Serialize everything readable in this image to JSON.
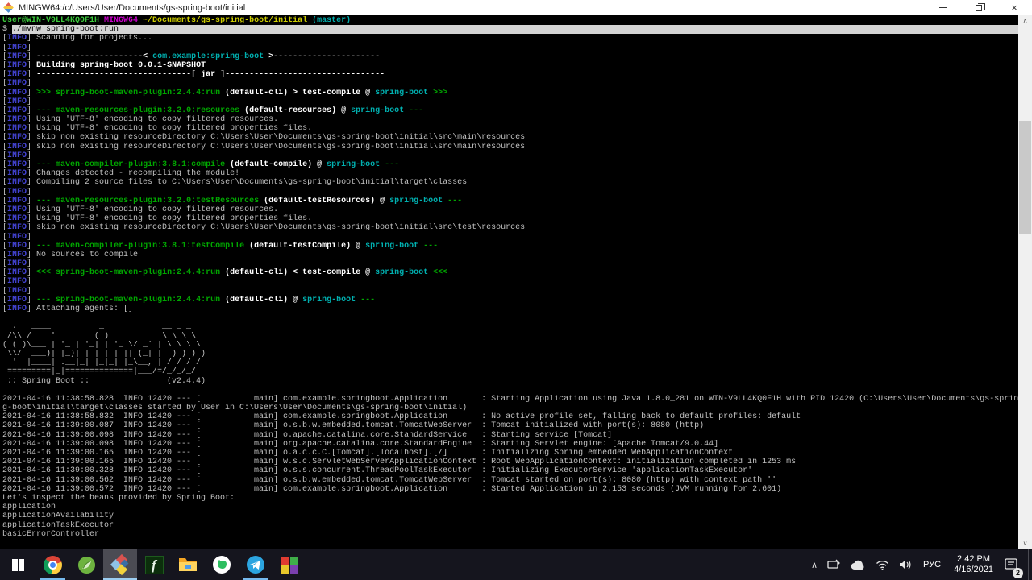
{
  "window": {
    "title": "MINGW64:/c/Users/User/Documents/gs-spring-boot/initial",
    "controls": {
      "minimize": "minimize",
      "restore": "restore",
      "close": "close"
    }
  },
  "colors": {
    "terminal_bg": "#000000",
    "default_text": "#c0c0c0",
    "info_blue": "#4444d6",
    "maven_green": "#00a600",
    "project_cyan": "#00b0b0",
    "prompt_green": "#3ccc3c",
    "path_yellow": "#cdcd00",
    "mingw_magenta": "#cd00cd",
    "selection_bg": "#d4d4d4",
    "taskbar_bg": "#15151e",
    "running_underline": "#76b9ed"
  },
  "terminal": {
    "lines": [
      {
        "s": [
          [
            "pg",
            "User@WIN-V9LL4KQ0F1H "
          ],
          [
            "m",
            "MINGW64 "
          ],
          [
            "y",
            "~/Documents/gs-spring-boot/initial "
          ],
          [
            "c",
            "(master)"
          ]
        ]
      },
      {
        "s": [
          [
            "d",
            "$ "
          ],
          [
            "sel",
            "./mvnw spring-boot:run"
          ]
        ]
      },
      {
        "s": [
          [
            "d",
            "["
          ],
          [
            "b",
            "INFO"
          ],
          [
            "d",
            "] Scanning for projects..."
          ]
        ]
      },
      {
        "s": [
          [
            "d",
            "["
          ],
          [
            "b",
            "INFO"
          ],
          [
            "d",
            "]"
          ]
        ]
      },
      {
        "s": [
          [
            "d",
            "["
          ],
          [
            "b",
            "INFO"
          ],
          [
            "d",
            "] "
          ],
          [
            "w",
            "----------------------< "
          ],
          [
            "c",
            "com.example:spring-boot"
          ],
          [
            "w",
            " >----------------------"
          ]
        ]
      },
      {
        "s": [
          [
            "d",
            "["
          ],
          [
            "b",
            "INFO"
          ],
          [
            "d",
            "] "
          ],
          [
            "w",
            "Building spring-boot 0.0.1-SNAPSHOT"
          ]
        ]
      },
      {
        "s": [
          [
            "d",
            "["
          ],
          [
            "b",
            "INFO"
          ],
          [
            "d",
            "] "
          ],
          [
            "w",
            "--------------------------------[ jar ]---------------------------------"
          ]
        ]
      },
      {
        "s": [
          [
            "d",
            "["
          ],
          [
            "b",
            "INFO"
          ],
          [
            "d",
            "]"
          ]
        ]
      },
      {
        "s": [
          [
            "d",
            "["
          ],
          [
            "b",
            "INFO"
          ],
          [
            "d",
            "] "
          ],
          [
            "g",
            ">>> spring-boot-maven-plugin:2.4.4:run "
          ],
          [
            "w",
            "(default-cli) > test-compile @ "
          ],
          [
            "c",
            "spring-boot"
          ],
          [
            "g",
            " >>>"
          ]
        ]
      },
      {
        "s": [
          [
            "d",
            "["
          ],
          [
            "b",
            "INFO"
          ],
          [
            "d",
            "]"
          ]
        ]
      },
      {
        "s": [
          [
            "d",
            "["
          ],
          [
            "b",
            "INFO"
          ],
          [
            "d",
            "] "
          ],
          [
            "g",
            "--- maven-resources-plugin:3.2.0:resources "
          ],
          [
            "w",
            "(default-resources) @ "
          ],
          [
            "c",
            "spring-boot"
          ],
          [
            "g",
            " ---"
          ]
        ]
      },
      {
        "s": [
          [
            "d",
            "["
          ],
          [
            "b",
            "INFO"
          ],
          [
            "d",
            "] Using 'UTF-8' encoding to copy filtered resources."
          ]
        ]
      },
      {
        "s": [
          [
            "d",
            "["
          ],
          [
            "b",
            "INFO"
          ],
          [
            "d",
            "] Using 'UTF-8' encoding to copy filtered properties files."
          ]
        ]
      },
      {
        "s": [
          [
            "d",
            "["
          ],
          [
            "b",
            "INFO"
          ],
          [
            "d",
            "] skip non existing resourceDirectory C:\\Users\\User\\Documents\\gs-spring-boot\\initial\\src\\main\\resources"
          ]
        ]
      },
      {
        "s": [
          [
            "d",
            "["
          ],
          [
            "b",
            "INFO"
          ],
          [
            "d",
            "] skip non existing resourceDirectory C:\\Users\\User\\Documents\\gs-spring-boot\\initial\\src\\main\\resources"
          ]
        ]
      },
      {
        "s": [
          [
            "d",
            "["
          ],
          [
            "b",
            "INFO"
          ],
          [
            "d",
            "]"
          ]
        ]
      },
      {
        "s": [
          [
            "d",
            "["
          ],
          [
            "b",
            "INFO"
          ],
          [
            "d",
            "] "
          ],
          [
            "g",
            "--- maven-compiler-plugin:3.8.1:compile "
          ],
          [
            "w",
            "(default-compile) @ "
          ],
          [
            "c",
            "spring-boot"
          ],
          [
            "g",
            " ---"
          ]
        ]
      },
      {
        "s": [
          [
            "d",
            "["
          ],
          [
            "b",
            "INFO"
          ],
          [
            "d",
            "] Changes detected - recompiling the module!"
          ]
        ]
      },
      {
        "s": [
          [
            "d",
            "["
          ],
          [
            "b",
            "INFO"
          ],
          [
            "d",
            "] Compiling 2 source files to C:\\Users\\User\\Documents\\gs-spring-boot\\initial\\target\\classes"
          ]
        ]
      },
      {
        "s": [
          [
            "d",
            "["
          ],
          [
            "b",
            "INFO"
          ],
          [
            "d",
            "]"
          ]
        ]
      },
      {
        "s": [
          [
            "d",
            "["
          ],
          [
            "b",
            "INFO"
          ],
          [
            "d",
            "] "
          ],
          [
            "g",
            "--- maven-resources-plugin:3.2.0:testResources "
          ],
          [
            "w",
            "(default-testResources) @ "
          ],
          [
            "c",
            "spring-boot"
          ],
          [
            "g",
            " ---"
          ]
        ]
      },
      {
        "s": [
          [
            "d",
            "["
          ],
          [
            "b",
            "INFO"
          ],
          [
            "d",
            "] Using 'UTF-8' encoding to copy filtered resources."
          ]
        ]
      },
      {
        "s": [
          [
            "d",
            "["
          ],
          [
            "b",
            "INFO"
          ],
          [
            "d",
            "] Using 'UTF-8' encoding to copy filtered properties files."
          ]
        ]
      },
      {
        "s": [
          [
            "d",
            "["
          ],
          [
            "b",
            "INFO"
          ],
          [
            "d",
            "] skip non existing resourceDirectory C:\\Users\\User\\Documents\\gs-spring-boot\\initial\\src\\test\\resources"
          ]
        ]
      },
      {
        "s": [
          [
            "d",
            "["
          ],
          [
            "b",
            "INFO"
          ],
          [
            "d",
            "]"
          ]
        ]
      },
      {
        "s": [
          [
            "d",
            "["
          ],
          [
            "b",
            "INFO"
          ],
          [
            "d",
            "] "
          ],
          [
            "g",
            "--- maven-compiler-plugin:3.8.1:testCompile "
          ],
          [
            "w",
            "(default-testCompile) @ "
          ],
          [
            "c",
            "spring-boot"
          ],
          [
            "g",
            " ---"
          ]
        ]
      },
      {
        "s": [
          [
            "d",
            "["
          ],
          [
            "b",
            "INFO"
          ],
          [
            "d",
            "] No sources to compile"
          ]
        ]
      },
      {
        "s": [
          [
            "d",
            "["
          ],
          [
            "b",
            "INFO"
          ],
          [
            "d",
            "]"
          ]
        ]
      },
      {
        "s": [
          [
            "d",
            "["
          ],
          [
            "b",
            "INFO"
          ],
          [
            "d",
            "] "
          ],
          [
            "g",
            "<<< spring-boot-maven-plugin:2.4.4:run "
          ],
          [
            "w",
            "(default-cli) < test-compile @ "
          ],
          [
            "c",
            "spring-boot"
          ],
          [
            "g",
            " <<<"
          ]
        ]
      },
      {
        "s": [
          [
            "d",
            "["
          ],
          [
            "b",
            "INFO"
          ],
          [
            "d",
            "]"
          ]
        ]
      },
      {
        "s": [
          [
            "d",
            "["
          ],
          [
            "b",
            "INFO"
          ],
          [
            "d",
            "]"
          ]
        ]
      },
      {
        "s": [
          [
            "d",
            "["
          ],
          [
            "b",
            "INFO"
          ],
          [
            "d",
            "] "
          ],
          [
            "g",
            "--- spring-boot-maven-plugin:2.4.4:run "
          ],
          [
            "w",
            "(default-cli) @ "
          ],
          [
            "c",
            "spring-boot"
          ],
          [
            "g",
            " ---"
          ]
        ]
      },
      {
        "s": [
          [
            "d",
            "["
          ],
          [
            "b",
            "INFO"
          ],
          [
            "d",
            "] Attaching agents: []"
          ]
        ]
      },
      {
        "s": []
      },
      {
        "s": [
          [
            "d",
            "  .   ____          _            __ _ _"
          ]
        ]
      },
      {
        "s": [
          [
            "d",
            " /\\\\ / ___'_ __ _ _(_)_ __  __ _ \\ \\ \\ \\"
          ]
        ]
      },
      {
        "s": [
          [
            "d",
            "( ( )\\___ | '_ | '_| | '_ \\/ _` | \\ \\ \\ \\"
          ]
        ]
      },
      {
        "s": [
          [
            "d",
            " \\\\/  ___)| |_)| | | | | || (_| |  ) ) ) )"
          ]
        ]
      },
      {
        "s": [
          [
            "d",
            "  '  |____| .__|_| |_|_| |_\\__, | / / / /"
          ]
        ]
      },
      {
        "s": [
          [
            "d",
            " =========|_|==============|___/=/_/_/_/"
          ]
        ]
      },
      {
        "s": [
          [
            "d",
            " :: Spring Boot ::                (v2.4.4)"
          ]
        ]
      },
      {
        "s": []
      },
      {
        "s": [
          [
            "d",
            "2021-04-16 11:38:58.828  INFO 12420 --- [           main] com.example.springboot.Application       : Starting Application using Java 1.8.0_281 on WIN-V9LL4KQ0F1H with PID 12420 (C:\\Users\\User\\Documents\\gs-sprin"
          ]
        ]
      },
      {
        "s": [
          [
            "d",
            "g-boot\\initial\\target\\classes started by User in C:\\Users\\User\\Documents\\gs-spring-boot\\initial)"
          ]
        ]
      },
      {
        "s": [
          [
            "d",
            "2021-04-16 11:38:58.832  INFO 12420 --- [           main] com.example.springboot.Application       : No active profile set, falling back to default profiles: default"
          ]
        ]
      },
      {
        "s": [
          [
            "d",
            "2021-04-16 11:39:00.087  INFO 12420 --- [           main] o.s.b.w.embedded.tomcat.TomcatWebServer  : Tomcat initialized with port(s): 8080 (http)"
          ]
        ]
      },
      {
        "s": [
          [
            "d",
            "2021-04-16 11:39:00.098  INFO 12420 --- [           main] o.apache.catalina.core.StandardService   : Starting service [Tomcat]"
          ]
        ]
      },
      {
        "s": [
          [
            "d",
            "2021-04-16 11:39:00.098  INFO 12420 --- [           main] org.apache.catalina.core.StandardEngine  : Starting Servlet engine: [Apache Tomcat/9.0.44]"
          ]
        ]
      },
      {
        "s": [
          [
            "d",
            "2021-04-16 11:39:00.165  INFO 12420 --- [           main] o.a.c.c.C.[Tomcat].[localhost].[/]       : Initializing Spring embedded WebApplicationContext"
          ]
        ]
      },
      {
        "s": [
          [
            "d",
            "2021-04-16 11:39:00.165  INFO 12420 --- [           main] w.s.c.ServletWebServerApplicationContext : Root WebApplicationContext: initialization completed in 1253 ms"
          ]
        ]
      },
      {
        "s": [
          [
            "d",
            "2021-04-16 11:39:00.328  INFO 12420 --- [           main] o.s.s.concurrent.ThreadPoolTaskExecutor  : Initializing ExecutorService 'applicationTaskExecutor'"
          ]
        ]
      },
      {
        "s": [
          [
            "d",
            "2021-04-16 11:39:00.562  INFO 12420 --- [           main] o.s.b.w.embedded.tomcat.TomcatWebServer  : Tomcat started on port(s): 8080 (http) with context path ''"
          ]
        ]
      },
      {
        "s": [
          [
            "d",
            "2021-04-16 11:39:00.572  INFO 12420 --- [           main] com.example.springboot.Application       : Started Application in 2.153 seconds (JVM running for 2.601)"
          ]
        ]
      },
      {
        "s": [
          [
            "d",
            "Let's inspect the beans provided by Spring Boot:"
          ]
        ]
      },
      {
        "s": [
          [
            "d",
            "application"
          ]
        ]
      },
      {
        "s": [
          [
            "d",
            "applicationAvailability"
          ]
        ]
      },
      {
        "s": [
          [
            "d",
            "applicationTaskExecutor"
          ]
        ]
      },
      {
        "s": [
          [
            "d",
            "basicErrorController"
          ]
        ]
      }
    ]
  },
  "taskbar": {
    "apps": [
      {
        "icon": "start-icon",
        "running": false,
        "active": false
      },
      {
        "icon": "chrome-icon",
        "running": true,
        "active": false
      },
      {
        "icon": "spring-tool-icon",
        "running": false,
        "active": false
      },
      {
        "icon": "git-bash-icon",
        "running": true,
        "active": true
      },
      {
        "icon": "fiddler-icon",
        "running": false,
        "active": false
      },
      {
        "icon": "file-explorer-icon",
        "running": false,
        "active": false
      },
      {
        "icon": "evernote-icon",
        "running": false,
        "active": false
      },
      {
        "icon": "telegram-icon",
        "running": true,
        "active": false
      },
      {
        "icon": "colored-tiles-app-icon",
        "running": false,
        "active": false
      }
    ],
    "tray": {
      "icons": [
        "hidden-icons-chevron",
        "tray-device-icon",
        "onedrive-cloud-icon",
        "wifi-icon",
        "volume-icon"
      ],
      "language": "РУС",
      "time": "2:42 PM",
      "date": "4/16/2021",
      "notification_badge": "2"
    }
  }
}
